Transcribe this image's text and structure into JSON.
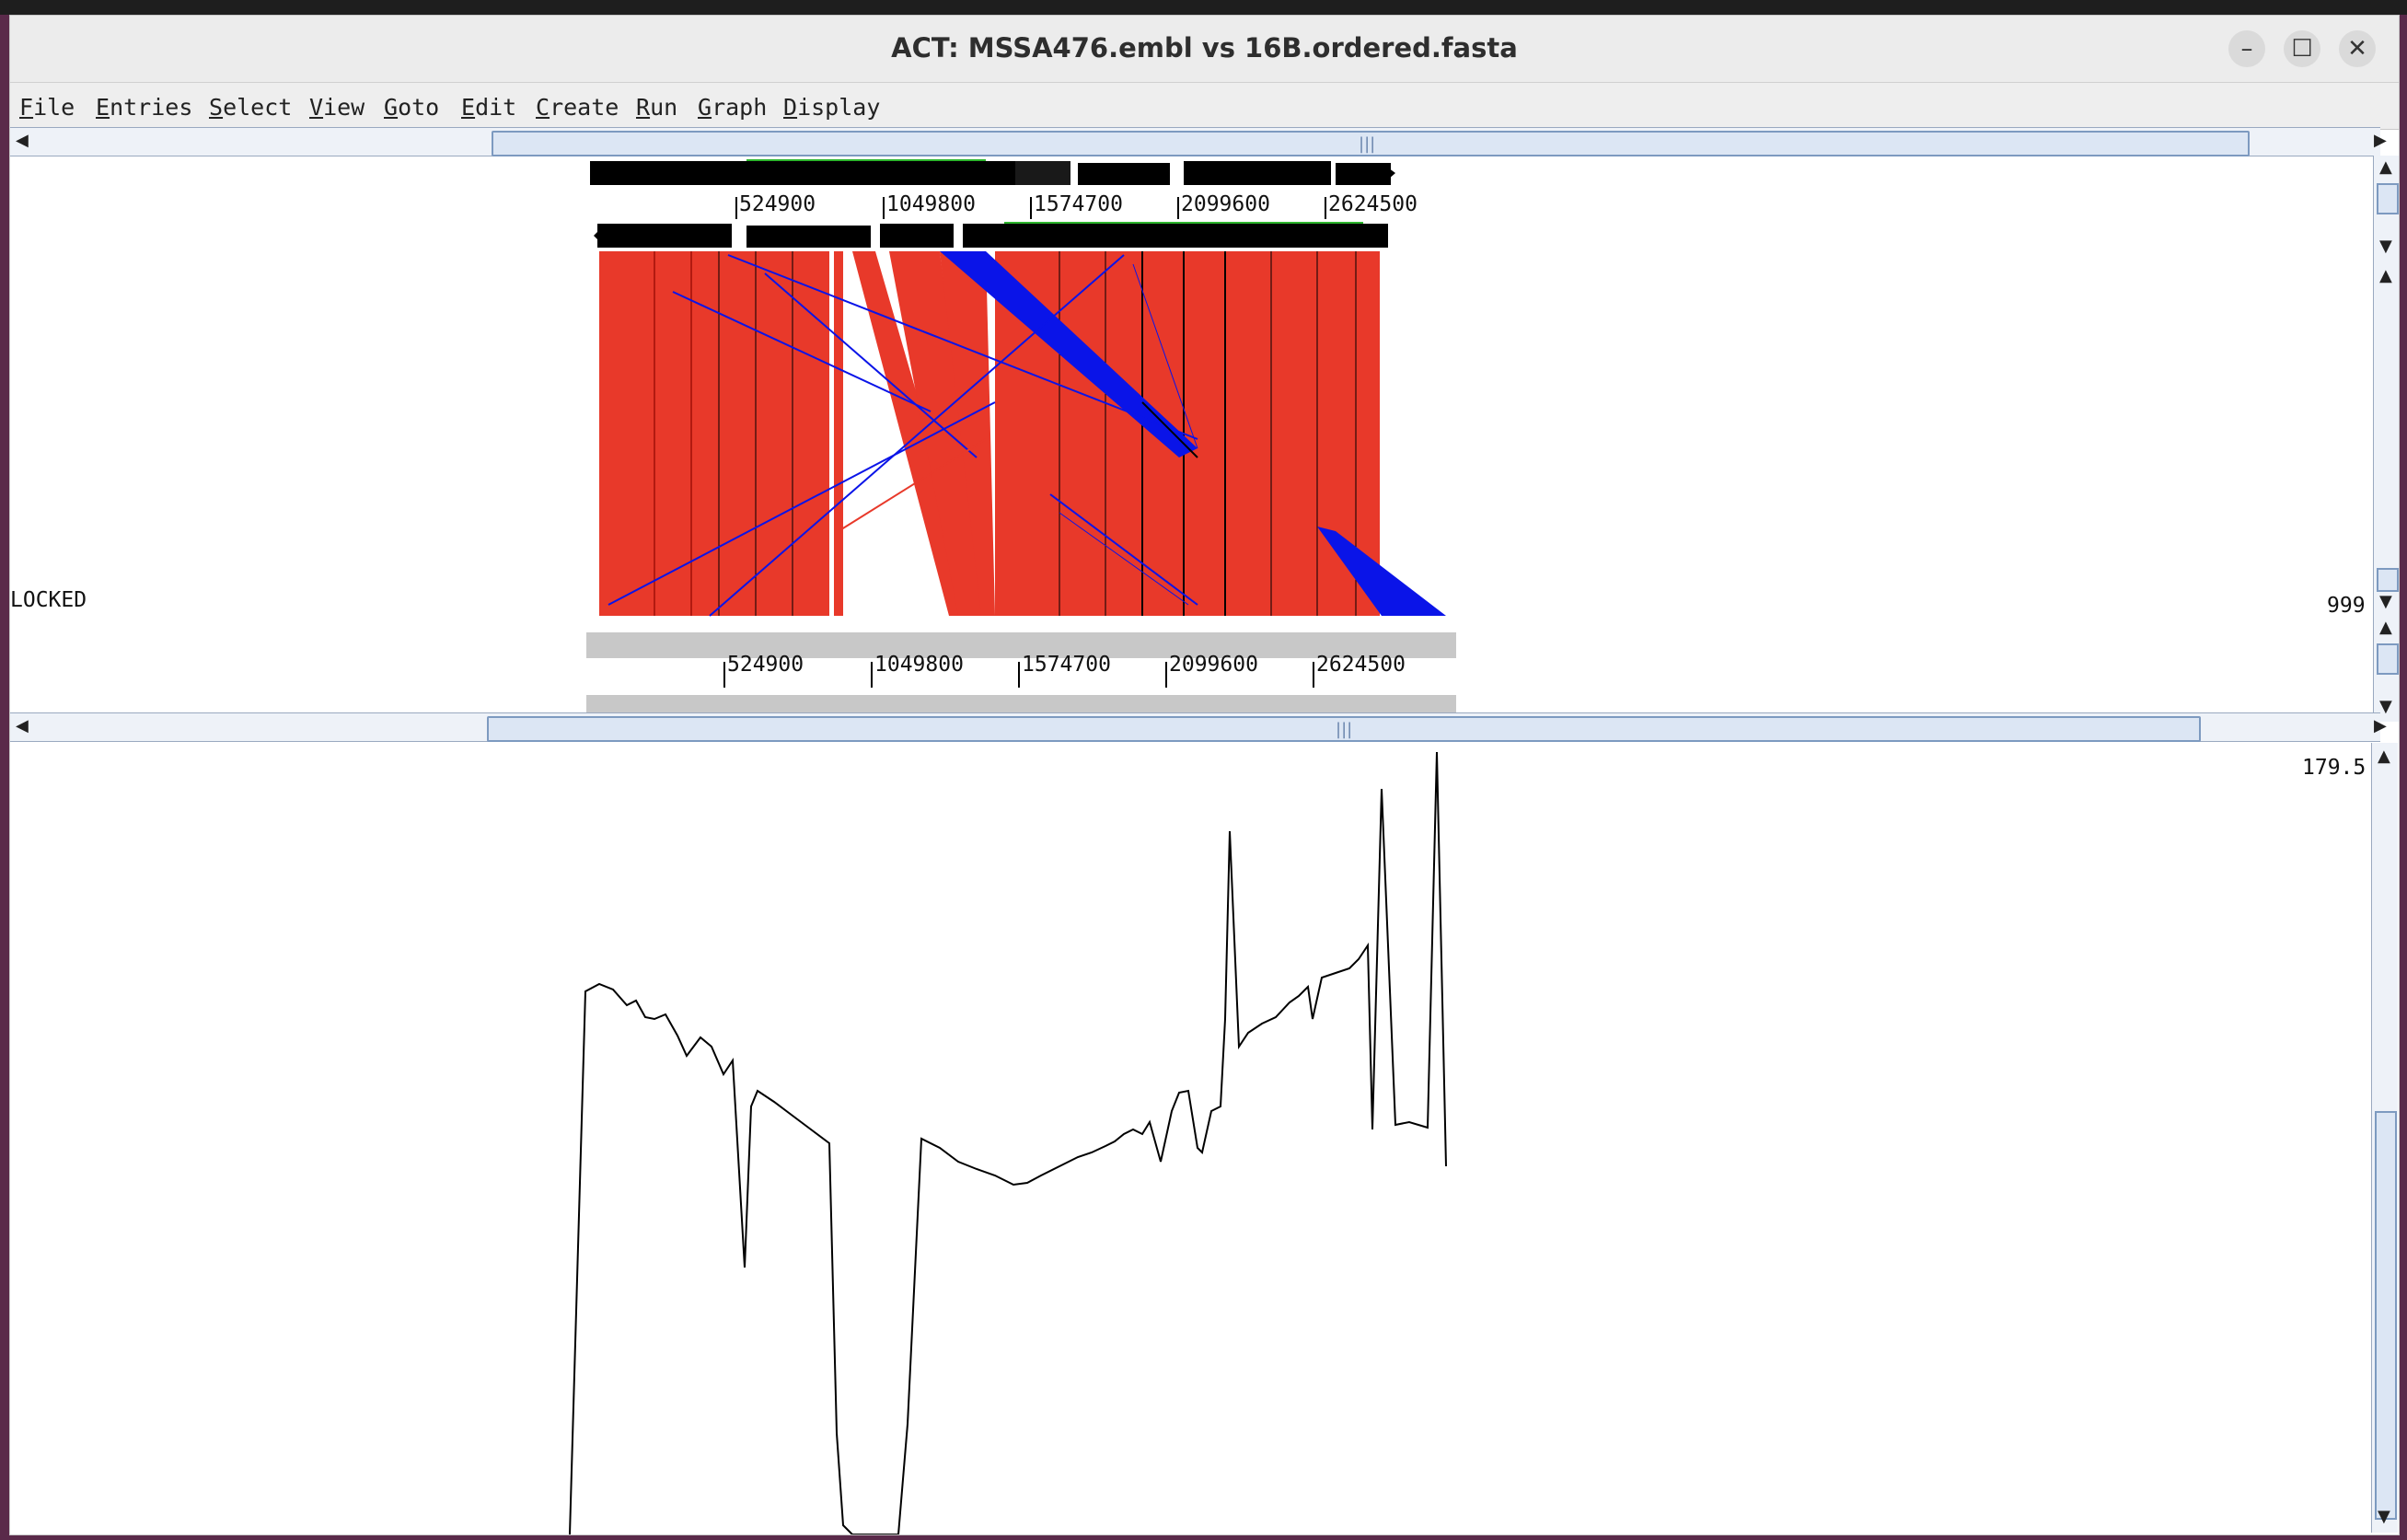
{
  "window": {
    "title": "ACT: MSSA476.embl vs 16B.ordered.fasta",
    "minimize_icon": "minimize-icon",
    "maximize_icon": "maximize-icon",
    "close_icon": "close-icon"
  },
  "menu": {
    "items": [
      {
        "u": "F",
        "rest": "ile"
      },
      {
        "u": "E",
        "rest": "ntries"
      },
      {
        "u": "S",
        "rest": "elect"
      },
      {
        "u": "V",
        "rest": "iew"
      },
      {
        "u": "G",
        "rest": "oto"
      },
      {
        "u": "E",
        "rest": "dit"
      },
      {
        "u": "C",
        "rest": "reate"
      },
      {
        "u": "R",
        "rest": "un"
      },
      {
        "u": "G",
        "rest": "raph"
      },
      {
        "u": "D",
        "rest": "isplay"
      }
    ]
  },
  "top_genome": {
    "ruler_ticks": [
      "524900",
      "1049800",
      "1574700",
      "2099600",
      "2624500"
    ]
  },
  "bottom_genome": {
    "ruler_ticks": [
      "524900",
      "1049800",
      "1574700",
      "2099600",
      "2624500"
    ]
  },
  "comparison": {
    "locked_label": "LOCKED",
    "score_label": "999"
  },
  "graph": {
    "max_label": "179.5"
  },
  "colors": {
    "match_forward": "#e8392a",
    "match_reverse": "#0a14e8",
    "feature_black": "#000000",
    "track_grey": "#c8c8c8"
  }
}
